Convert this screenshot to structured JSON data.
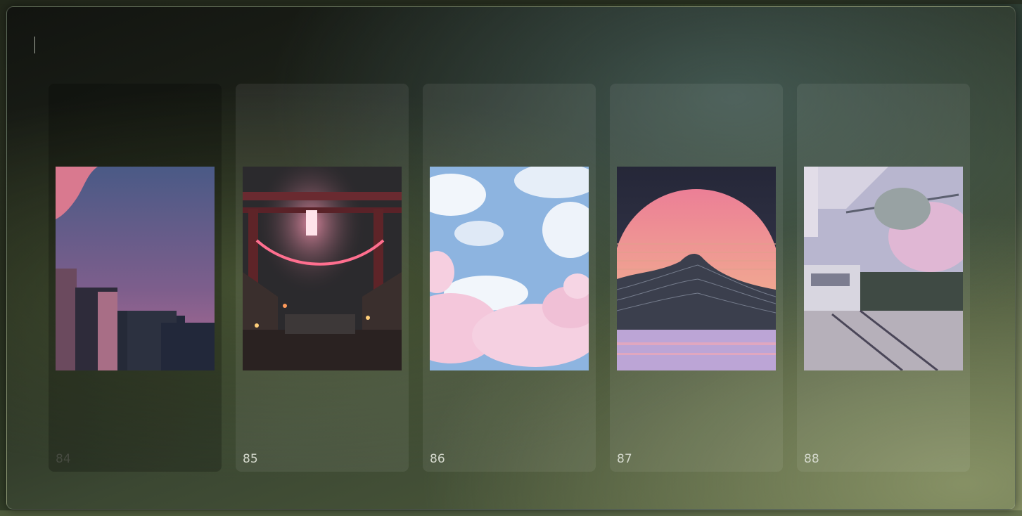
{
  "search": {
    "value": ""
  },
  "wallpapers": [
    {
      "label": "84",
      "icon": "city-dusk-thumbnail",
      "selected": false
    },
    {
      "label": "85",
      "icon": "torii-gate-lantern-thumbnail",
      "selected": true
    },
    {
      "label": "86",
      "icon": "sky-cherry-blossom-thumbnail",
      "selected": true
    },
    {
      "label": "87",
      "icon": "synthwave-sun-mountain-thumbnail",
      "selected": true
    },
    {
      "label": "88",
      "icon": "train-cherry-tree-thumbnail",
      "selected": true
    }
  ],
  "colors": {
    "label_text": "#d4d8cc",
    "dim_label_text": "#464a40"
  }
}
